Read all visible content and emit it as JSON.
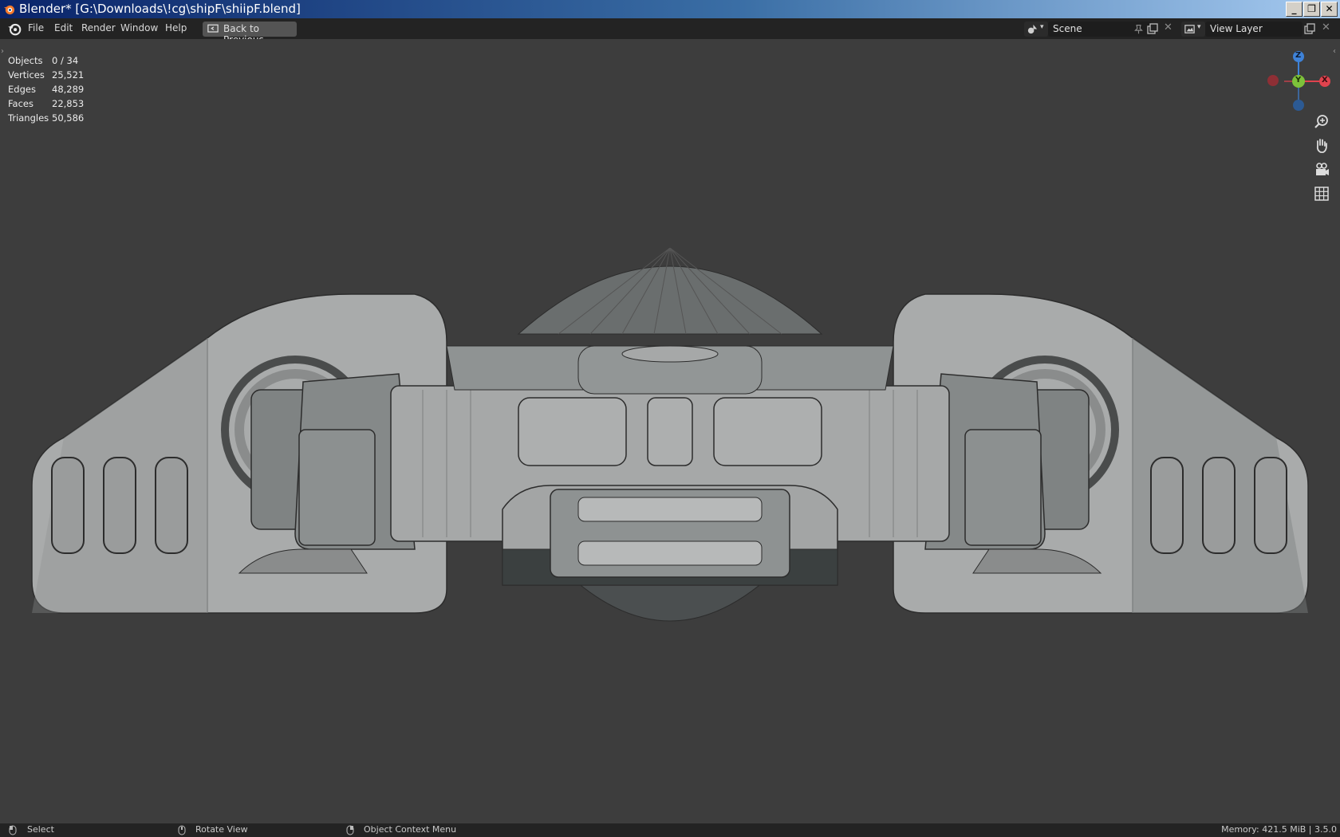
{
  "window": {
    "title": "Blender* [G:\\Downloads\\!cg\\shipF\\shiipF.blend]",
    "controls": {
      "minimize": "_",
      "maximize": "❐",
      "close": "✕"
    }
  },
  "menu": {
    "items": [
      "File",
      "Edit",
      "Render",
      "Window",
      "Help"
    ],
    "back_button": "Back to Previous"
  },
  "header": {
    "scene": "Scene",
    "view_layer": "View Layer"
  },
  "stats": [
    {
      "label": "Objects",
      "value": "0 / 34"
    },
    {
      "label": "Vertices",
      "value": "25,521"
    },
    {
      "label": "Edges",
      "value": "48,289"
    },
    {
      "label": "Faces",
      "value": "22,853"
    },
    {
      "label": "Triangles",
      "value": "50,586"
    }
  ],
  "gizmo": {
    "z": "Z",
    "y": "Y",
    "x": "X"
  },
  "statusbar": {
    "select": "Select",
    "rotate": "Rotate View",
    "context": "Object Context Menu",
    "memory": "Memory: 421.5 MiB | 3.5.0"
  },
  "colors": {
    "axis_x": "#e0434e",
    "axis_y": "#7dc13a",
    "axis_z": "#3e82d8",
    "viewport_bg": "#3d3d3d",
    "header_bg": "#232323"
  },
  "icons": [
    "blender-logo-icon",
    "screen-back-icon",
    "scene-icon",
    "view-layer-icon",
    "pin-icon",
    "duplicate-icon",
    "close-icon",
    "zoom-icon",
    "hand-pan-icon",
    "camera-icon",
    "grid-icon",
    "mouse-left-icon",
    "mouse-middle-icon",
    "mouse-right-icon"
  ]
}
